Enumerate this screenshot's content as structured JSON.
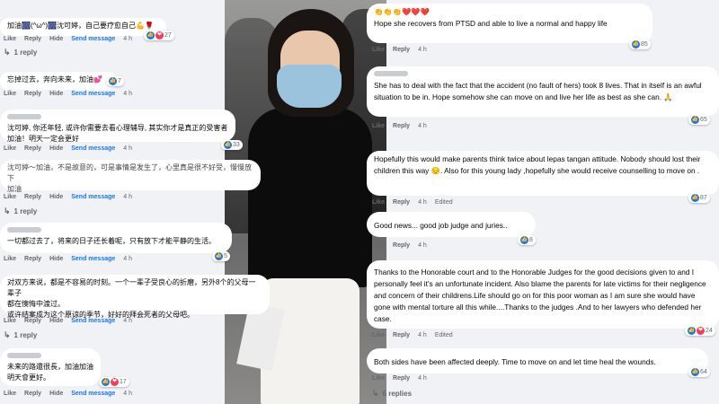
{
  "labels": {
    "like": "Like",
    "reply": "Reply",
    "hide": "Hide",
    "send": "Send message"
  },
  "left": [
    {
      "text": "加油🎆(^ω^)🎆沈可婷，自己要疗愈自己💪🌹",
      "age": "4 h",
      "reacts": "27",
      "replies": "1 reply"
    },
    {
      "text": "忘掉过去，奔向未来，加油💕",
      "age": "4 h",
      "reacts": "7"
    },
    {
      "text": "沈可婷, 你还年轻, 或许你需要去看心理辅导, 其实你才是真正的受害者\n加油！明天一定会更好",
      "age": "4 h",
      "reacts": "33"
    },
    {
      "text": "沈可婷～加油，不是故意的，可是事情是发生了，心里真是很不好受，慢慢放下\n加油",
      "age": "4 h",
      "replies": "1 reply"
    },
    {
      "text": "一切都过去了，将来的日子还长着呢，只有放下才能平静的生活。",
      "age": "4 h",
      "reacts": "5"
    },
    {
      "text": "对双方来说，都是不容易的时刻。一个一辈子受良心的折磨，另外8个的父母一辈子\n都在懊悔中渡过。\n或许结案成为这个原谅的季节，好好的拜会死者的父母吧。",
      "age": "4 h",
      "replies": "1 reply"
    },
    {
      "text": "未来的路還很長，加油加油\n明天會更好。",
      "age": "4 h",
      "reacts": "17"
    }
  ],
  "right": [
    {
      "text": "👏👏👏❤️❤️❤️\nHope she recovers from PTSD and able to live a normal and happy life",
      "age": "4 h",
      "reacts": "85"
    },
    {
      "text": "She has to deal with the fact that the accident (no fault of hers) took 8 lives. That in itself is an awful situation to be in. Hope somehow she can move on and live her life as best as she can. 🙏",
      "age": "4 h",
      "reacts": "65"
    },
    {
      "text": "Hopefully this would make parents think twice about lepas tangan attitude. Nobody should lost their children this way 😔. Also for this young lady ,hopefully she would receive counselling to move on .",
      "age": "4 h",
      "edited": "Edited",
      "reacts": "87"
    },
    {
      "text": "Good news... good job judge and juries..",
      "age": "4 h",
      "reacts": "8"
    },
    {
      "text": "Thanks to the Honorable court and to the Honorable Judges for the good decisions given to and I personally feel it's an unfortunate incident. Also blame the parents for late victims for their negligence and concern of their childrens.Life should go on for this poor woman as I am sure she would have gone with mental torture all this while....Thanks to the judges .And to her lawyers who defended her case.",
      "age": "4 h",
      "edited": "Edited",
      "reacts": "24"
    },
    {
      "text": "Both sides have been affected deeply. Time to move on and let time heal the wounds.",
      "age": "4 h",
      "reacts": "64",
      "replies": "6 replies"
    }
  ]
}
